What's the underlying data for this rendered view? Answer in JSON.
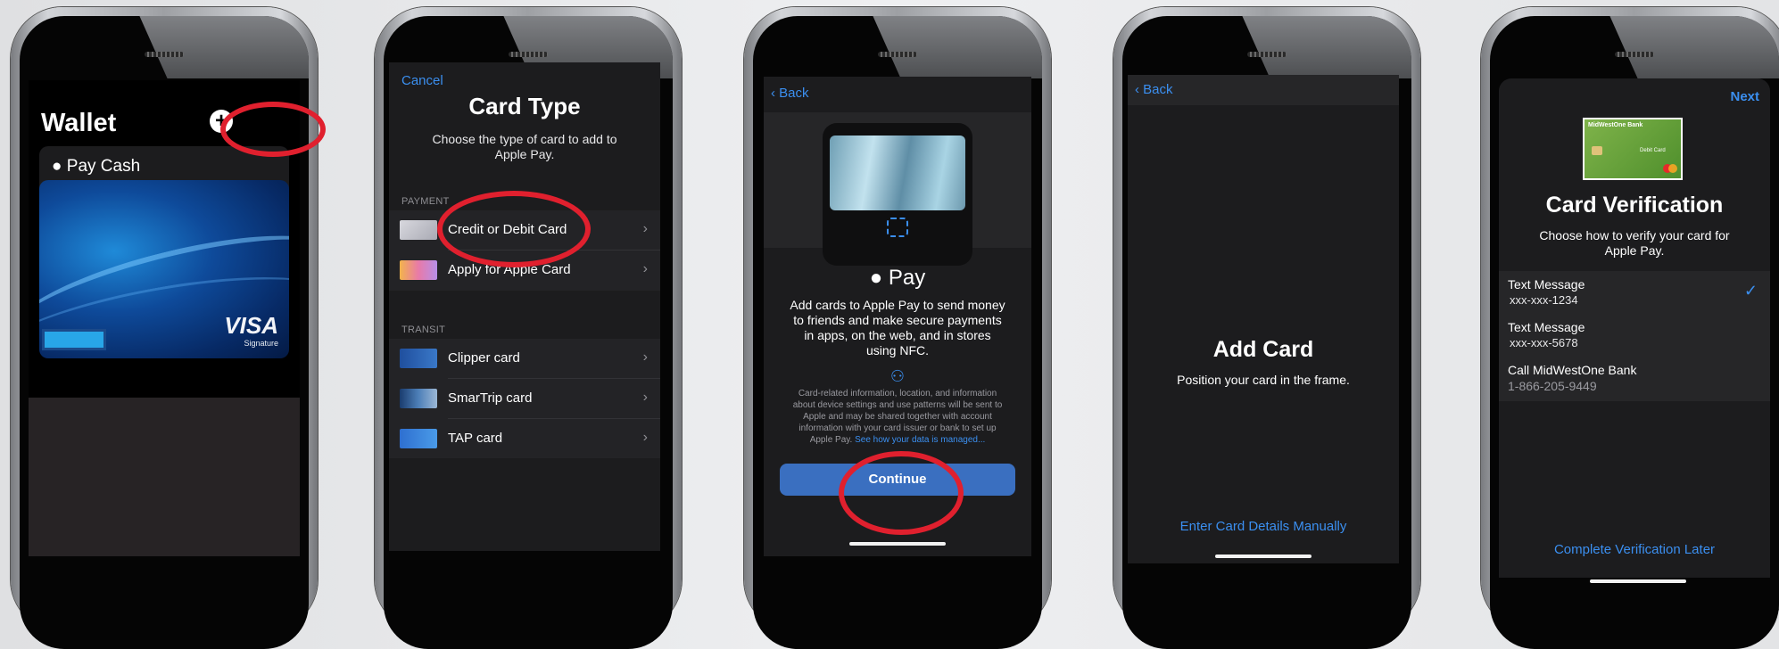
{
  "screen1": {
    "title": "Wallet",
    "add_symbol": "+",
    "pay_cash_label": "Pay Cash",
    "visa_label": "VISA",
    "visa_sub": "Signature"
  },
  "screen2": {
    "cancel": "Cancel",
    "title": "Card Type",
    "subtitle_line1": "Choose the type of card to add to",
    "subtitle_line2": "Apple Pay.",
    "payment_header": "PAYMENT",
    "payment_items": [
      "Credit or Debit Card",
      "Apply for Apple Card"
    ],
    "transit_header": "TRANSIT",
    "transit_items": [
      "Clipper card",
      "SmarTrip card",
      "TAP card"
    ]
  },
  "screen3": {
    "back": "Back",
    "pay_logo": "Pay",
    "desc_lines": [
      "Add cards to Apple Pay to send money",
      "to friends and make secure payments",
      "in apps, on the web, and in stores",
      "using NFC."
    ],
    "privacy_lines": [
      "Card-related information, location, and information",
      "about device settings and use patterns will be sent to",
      "Apple and may be shared together with account",
      "information with your card issuer or bank to set up"
    ],
    "privacy_last": "Apple Pay.",
    "privacy_link": "See how your data is managed...",
    "continue": "Continue"
  },
  "screen4": {
    "back": "Back",
    "title": "Add Card",
    "subtitle": "Position your card in the frame.",
    "manual": "Enter Card Details Manually"
  },
  "screen5": {
    "next": "Next",
    "bank_card_name": "MidWestOne Bank",
    "debit_label": "Debit Card",
    "title": "Card Verification",
    "subtitle_line1": "Choose how to verify your card for",
    "subtitle_line2": "Apple Pay.",
    "options": [
      {
        "label": "Text Message",
        "detail": "xxx-xxx-1234",
        "selected": true
      },
      {
        "label": "Text Message",
        "detail": "xxx-xxx-5678",
        "selected": false
      },
      {
        "label": "Call MidWestOne Bank",
        "detail": "1-866-205-9449",
        "selected": false
      }
    ],
    "later": "Complete Verification Later"
  },
  "colors": {
    "accent": "#3b8ff0",
    "highlight": "#e0202e",
    "continue_button": "#3a6fc0"
  }
}
